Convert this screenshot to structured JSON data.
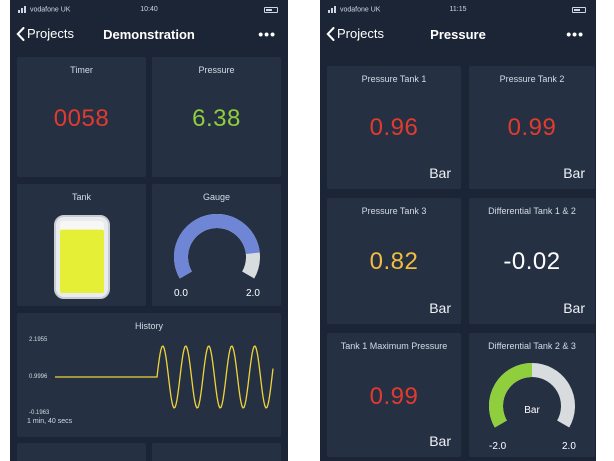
{
  "left": {
    "status": {
      "carrier": "vodafone UK",
      "time": "10:40"
    },
    "nav": {
      "back_label": "Projects",
      "title": "Demonstration",
      "more": "•••"
    },
    "tiles": {
      "timer": {
        "title": "Timer",
        "value": "0058"
      },
      "pressure": {
        "title": "Pressure",
        "value": "6.38"
      },
      "tank": {
        "title": "Tank",
        "fill_fraction": 0.88
      },
      "gauge": {
        "title": "Gauge",
        "min_label": "0.0",
        "max_label": "2.0",
        "value_fraction": 0.85
      },
      "history": {
        "title": "History",
        "y_max": "2.1955",
        "y_mid": "0.9996",
        "y_min": "-0.1963",
        "duration": "1 min, 40 secs"
      }
    }
  },
  "right": {
    "status": {
      "carrier": "vodafone UK",
      "time": "11:15"
    },
    "nav": {
      "back_label": "Projects",
      "title": "Pressure",
      "more": "•••"
    },
    "tiles": {
      "t1": {
        "title": "Pressure Tank 1",
        "value": "0.96",
        "unit": "Bar"
      },
      "t2": {
        "title": "Pressure Tank 2",
        "value": "0.99",
        "unit": "Bar"
      },
      "t3": {
        "title": "Pressure Tank 3",
        "value": "0.82",
        "unit": "Bar"
      },
      "d12": {
        "title": "Differential Tank 1 & 2",
        "value": "-0.02",
        "unit": "Bar"
      },
      "tmax": {
        "title": "Tank 1 Maximum Pressure",
        "value": "0.99",
        "unit": "Bar"
      },
      "d23": {
        "title": "Differential Tank 2 & 3",
        "unit": "Bar",
        "min_label": "-2.0",
        "max_label": "2.0",
        "value_fraction": 0.5
      }
    }
  },
  "colors": {
    "bg": "#1b2535",
    "tile": "#253143",
    "red": "#e23a2e",
    "green": "#8fce3c",
    "amber": "#f3bc3e",
    "gauge_blue": "#6f86d6",
    "gauge_green": "#8fce3c",
    "gauge_track": "#d9dcdf",
    "tank_fill": "#e4ef36"
  }
}
